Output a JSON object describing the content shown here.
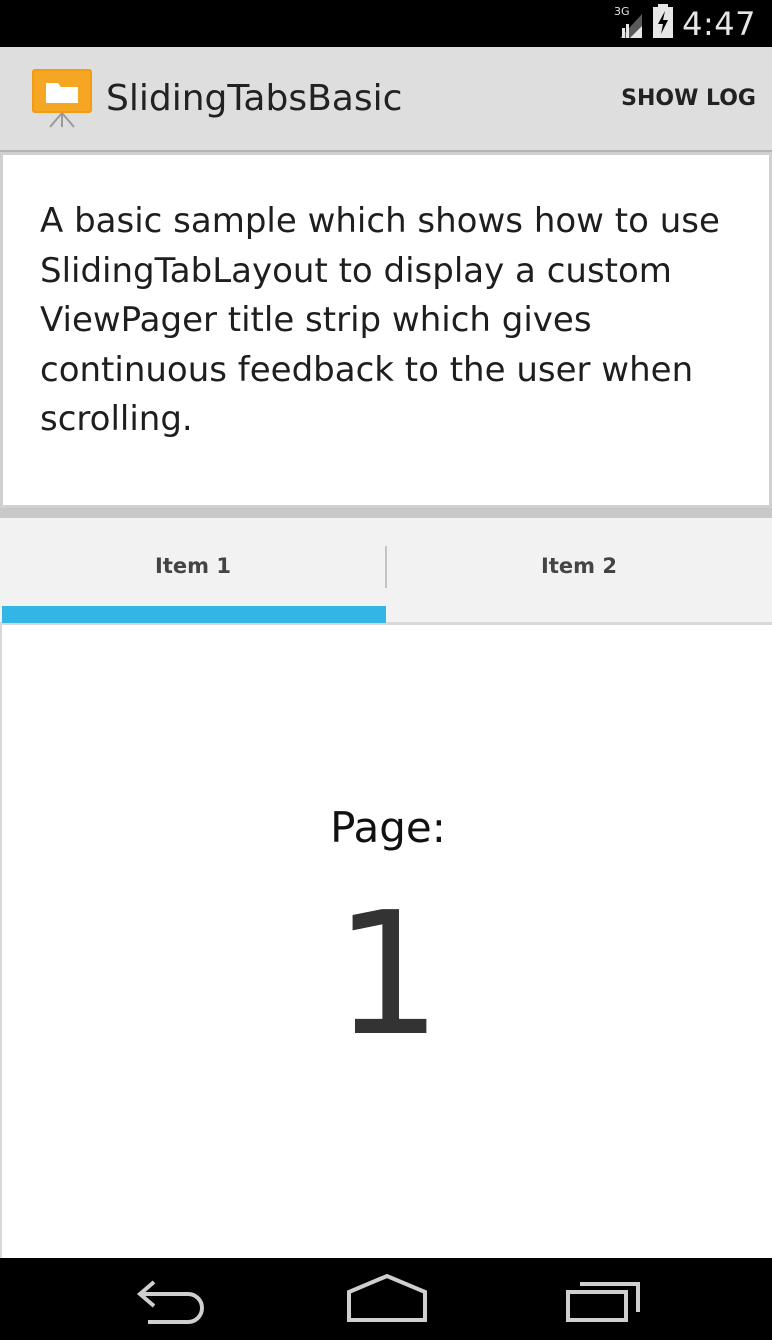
{
  "status_bar": {
    "network": "3G",
    "time": "4:47"
  },
  "action_bar": {
    "title": "SlidingTabsBasic",
    "action": "SHOW LOG",
    "icon": "presentation-folder-icon"
  },
  "intro": {
    "text": "A basic sample which shows how to use SlidingTabLayout to display a custom ViewPager title strip which gives continuous feedback to the user when scrolling."
  },
  "tabs": [
    {
      "label": "Item 1",
      "selected": true
    },
    {
      "label": "Item 2",
      "selected": false
    }
  ],
  "page": {
    "label": "Page:",
    "number": "1"
  },
  "nav_bar": {
    "buttons": [
      "back-icon",
      "home-icon",
      "recents-icon"
    ]
  },
  "colors": {
    "accent": "#33b5e5",
    "action_bar": "#dedede",
    "tab_strip": "#f2f2f2",
    "app_icon": "#f39c12"
  }
}
